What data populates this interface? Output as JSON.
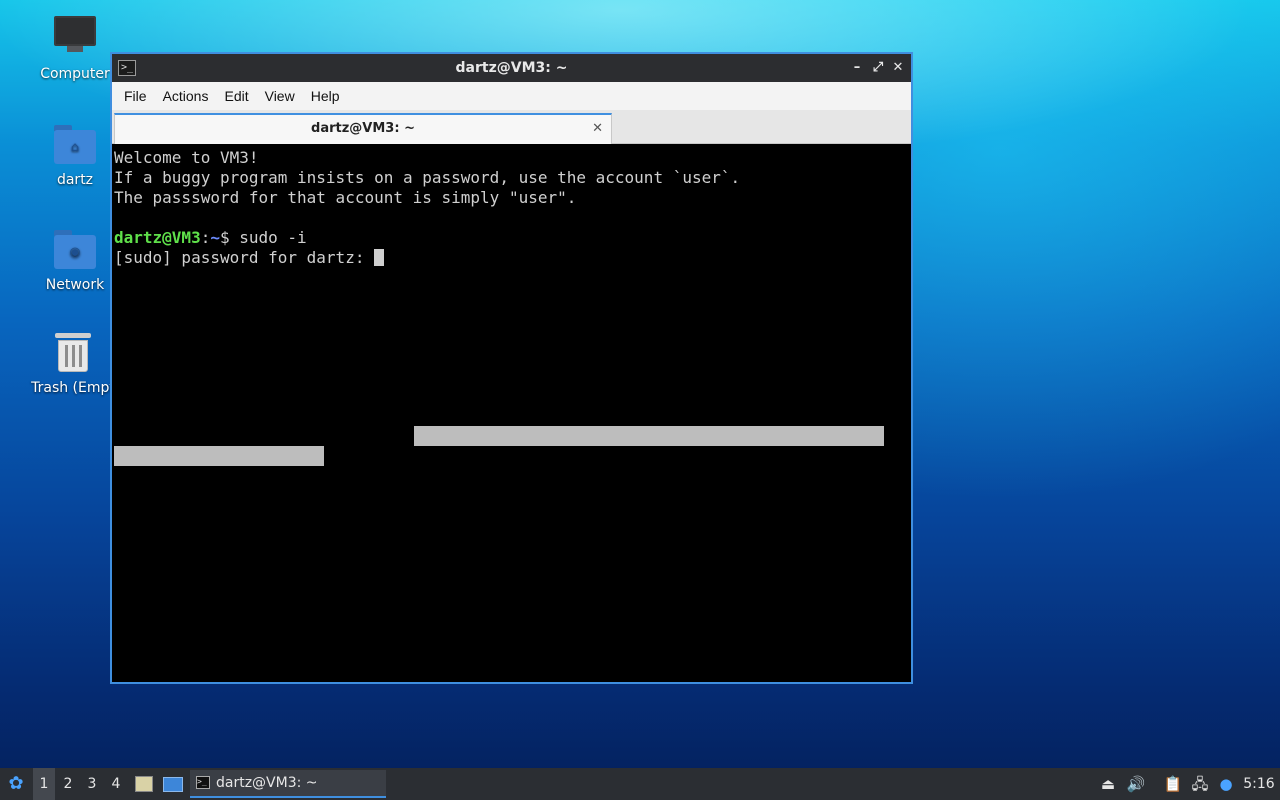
{
  "desktop": {
    "icons": [
      {
        "label": "Computer",
        "icon": "computer-icon"
      },
      {
        "label": "dartz",
        "icon": "home-folder-icon"
      },
      {
        "label": "Network",
        "icon": "network-folder-icon"
      },
      {
        "label": "Trash (Empt",
        "icon": "trash-icon"
      }
    ]
  },
  "window": {
    "title": "dartz@VM3: ~",
    "controls": {
      "minimize": "–",
      "maximize": "⤢",
      "close": "✕"
    },
    "menu": [
      "File",
      "Actions",
      "Edit",
      "View",
      "Help"
    ],
    "tab": {
      "label": "dartz@VM3: ~",
      "close": "✕"
    }
  },
  "terminal": {
    "lines": [
      "Welcome to VM3!",
      "If a buggy program insists on a password, use the account `user`.",
      "The passsword for that account is simply \"user\"."
    ],
    "prompt_user": "dartz@VM3",
    "prompt_sep": ":",
    "prompt_path": "~",
    "prompt_symbol": "$ ",
    "command": "sudo -i",
    "sudo_prompt": "[sudo] password for dartz: "
  },
  "taskbar": {
    "workspaces": [
      "1",
      "2",
      "3",
      "4"
    ],
    "active_workspace": "1",
    "task_label": "dartz@VM3: ~",
    "clock": "5:16"
  },
  "colors": {
    "accent": "#3f8fe0",
    "prompt_user": "#5fe04a",
    "prompt_path": "#6c8cff",
    "terminal_bg": "#000000"
  }
}
